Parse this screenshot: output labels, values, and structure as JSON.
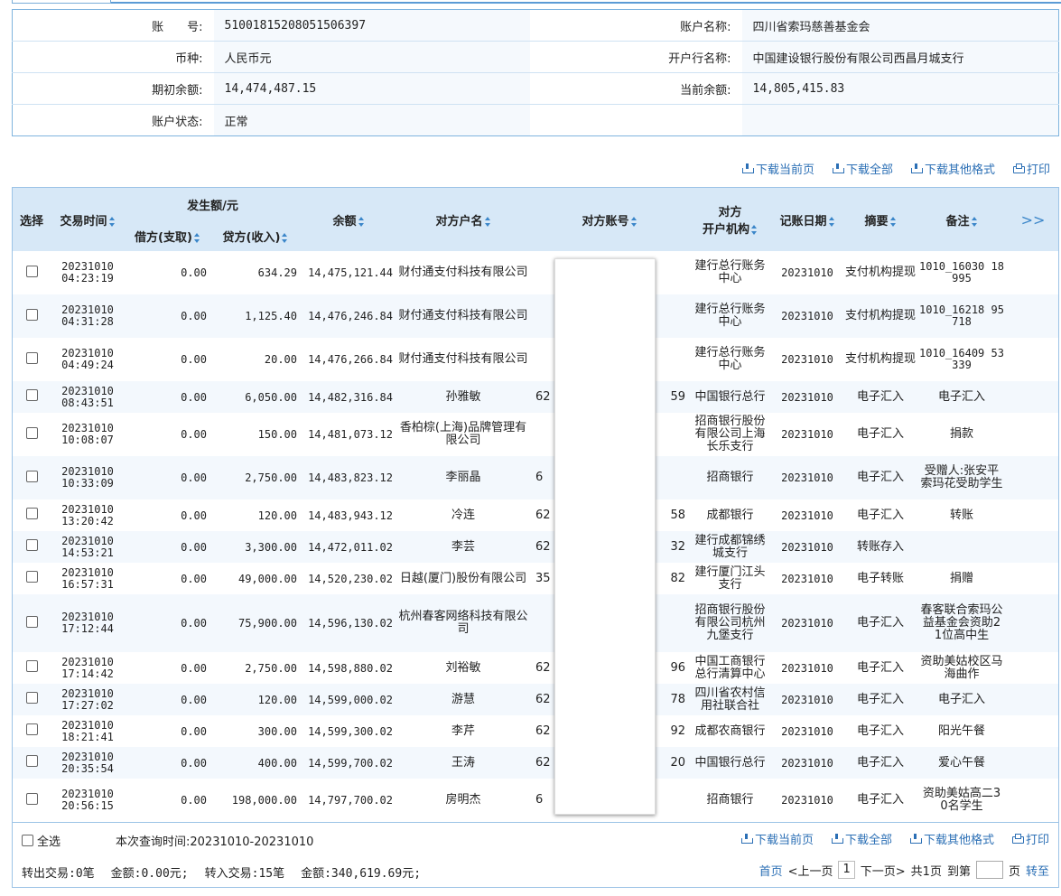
{
  "account": {
    "acct_no_label": "账　　号:",
    "acct_no": "51001815208051506397",
    "acct_name_label": "账户名称:",
    "acct_name": "四川省索玛慈善基金会",
    "currency_label": "币种:",
    "currency": "人民币元",
    "bank_label": "开户行名称:",
    "bank": "中国建设银行股份有限公司西昌月城支行",
    "opening_label": "期初余额:",
    "opening": "14,474,487.15",
    "current_label": "当前余额:",
    "current": "14,805,415.83",
    "status_label": "账户状态:",
    "status": "正常"
  },
  "toolbar": {
    "download_page": "下载当前页",
    "download_all": "下载全部",
    "download_other": "下载其他格式",
    "print": "打印"
  },
  "headers": {
    "select": "选择",
    "time": "交易时间",
    "amount_group": "发生额/元",
    "debit": "借方(支取)",
    "credit": "贷方(收入)",
    "balance": "余额",
    "cp_name": "对方户名",
    "cp_acct": "对方账号",
    "cp_bank_l1": "对方",
    "cp_bank_l2": "开户机构",
    "book_date": "记账日期",
    "summary": "摘要",
    "remark": "备注",
    "more": ">>"
  },
  "rows": [
    {
      "date": "20231010",
      "time": "04:23:19",
      "debit": "0.00",
      "credit": "634.29",
      "balance": "14,475,121.44",
      "cp_name": "财付通支付科技有限公司",
      "acct_l": "",
      "acct_r": "",
      "cp_bank": "建行总行账务中心",
      "book": "20231010",
      "summary": "支付机构提现",
      "remark": "1010_16030 18995",
      "remark_mono": true
    },
    {
      "date": "20231010",
      "time": "04:31:28",
      "debit": "0.00",
      "credit": "1,125.40",
      "balance": "14,476,246.84",
      "cp_name": "财付通支付科技有限公司",
      "acct_l": "",
      "acct_r": "",
      "cp_bank": "建行总行账务中心",
      "book": "20231010",
      "summary": "支付机构提现",
      "remark": "1010_16218 95718",
      "remark_mono": true
    },
    {
      "date": "20231010",
      "time": "04:49:24",
      "debit": "0.00",
      "credit": "20.00",
      "balance": "14,476,266.84",
      "cp_name": "财付通支付科技有限公司",
      "acct_l": "",
      "acct_r": "",
      "cp_bank": "建行总行账务中心",
      "book": "20231010",
      "summary": "支付机构提现",
      "remark": "1010_16409 53339",
      "remark_mono": true
    },
    {
      "date": "20231010",
      "time": "08:43:51",
      "debit": "0.00",
      "credit": "6,050.00",
      "balance": "14,482,316.84",
      "cp_name": "孙雅敏",
      "acct_l": "62",
      "acct_r": "59",
      "cp_bank": "中国银行总行",
      "book": "20231010",
      "summary": "电子汇入",
      "remark": "电子汇入",
      "remark_mono": false
    },
    {
      "date": "20231010",
      "time": "10:08:07",
      "debit": "0.00",
      "credit": "150.00",
      "balance": "14,481,073.12",
      "cp_name": "香柏棕(上海)品牌管理有限公司",
      "acct_l": "",
      "acct_r": "",
      "cp_bank": "招商银行股份有限公司上海长乐支行",
      "book": "20231010",
      "summary": "电子汇入",
      "remark": "捐款",
      "remark_mono": false
    },
    {
      "date": "20231010",
      "time": "10:33:09",
      "debit": "0.00",
      "credit": "2,750.00",
      "balance": "14,483,823.12",
      "cp_name": "李丽晶",
      "acct_l": "6",
      "acct_r": "",
      "cp_bank": "招商银行",
      "book": "20231010",
      "summary": "电子汇入",
      "remark": "受赠人:张安平索玛花受助学生",
      "remark_mono": false
    },
    {
      "date": "20231010",
      "time": "13:20:42",
      "debit": "0.00",
      "credit": "120.00",
      "balance": "14,483,943.12",
      "cp_name": "冷连",
      "acct_l": "62",
      "acct_r": "58",
      "cp_bank": "成都银行",
      "book": "20231010",
      "summary": "电子汇入",
      "remark": "转账",
      "remark_mono": false
    },
    {
      "date": "20231010",
      "time": "14:53:21",
      "debit": "0.00",
      "credit": "3,300.00",
      "balance": "14,472,011.02",
      "cp_name": "李芸",
      "acct_l": "62",
      "acct_r": "32",
      "cp_bank": "建行成都锦绣城支行",
      "book": "20231010",
      "summary": "转账存入",
      "remark": "",
      "remark_mono": false
    },
    {
      "date": "20231010",
      "time": "16:57:31",
      "debit": "0.00",
      "credit": "49,000.00",
      "balance": "14,520,230.02",
      "cp_name": "日越(厦门)股份有限公司",
      "acct_l": "35",
      "acct_r": "82",
      "cp_bank": "建行厦门江头支行",
      "book": "20231010",
      "summary": "电子转账",
      "remark": "捐赠",
      "remark_mono": false
    },
    {
      "date": "20231010",
      "time": "17:12:44",
      "debit": "0.00",
      "credit": "75,900.00",
      "balance": "14,596,130.02",
      "cp_name": "杭州春客网络科技有限公司",
      "acct_l": "",
      "acct_r": "",
      "cp_bank": "招商银行股份有限公司杭州九堡支行",
      "book": "20231010",
      "summary": "电子汇入",
      "remark": "春客联合索玛公益基金会资助21位高中生",
      "remark_mono": false
    },
    {
      "date": "20231010",
      "time": "17:14:42",
      "debit": "0.00",
      "credit": "2,750.00",
      "balance": "14,598,880.02",
      "cp_name": "刘裕敏",
      "acct_l": "62",
      "acct_r": "96",
      "cp_bank": "中国工商银行总行清算中心",
      "book": "20231010",
      "summary": "电子汇入",
      "remark": "资助美姑校区马海曲作",
      "remark_mono": false
    },
    {
      "date": "20231010",
      "time": "17:27:02",
      "debit": "0.00",
      "credit": "120.00",
      "balance": "14,599,000.02",
      "cp_name": "游慧",
      "acct_l": "62",
      "acct_r": "78",
      "cp_bank": "四川省农村信用社联合社",
      "book": "20231010",
      "summary": "电子汇入",
      "remark": "电子汇入",
      "remark_mono": false
    },
    {
      "date": "20231010",
      "time": "18:21:41",
      "debit": "0.00",
      "credit": "300.00",
      "balance": "14,599,300.02",
      "cp_name": "李芹",
      "acct_l": "62",
      "acct_r": "92",
      "cp_bank": "成都农商银行",
      "book": "20231010",
      "summary": "电子汇入",
      "remark": "阳光午餐",
      "remark_mono": false
    },
    {
      "date": "20231010",
      "time": "20:35:54",
      "debit": "0.00",
      "credit": "400.00",
      "balance": "14,599,700.02",
      "cp_name": "王涛",
      "acct_l": "62",
      "acct_r": "20",
      "cp_bank": "中国银行总行",
      "book": "20231010",
      "summary": "电子汇入",
      "remark": "爱心午餐",
      "remark_mono": false
    },
    {
      "date": "20231010",
      "time": "20:56:15",
      "debit": "0.00",
      "credit": "198,000.00",
      "balance": "14,797,700.02",
      "cp_name": "房明杰",
      "acct_l": "6",
      "acct_r": "",
      "cp_bank": "招商银行",
      "book": "20231010",
      "summary": "电子汇入",
      "remark": "资助美姑高二30名学生",
      "remark_mono": false
    }
  ],
  "row_heights": [],
  "footer": {
    "select_all": "全选",
    "query_time": "本次查询时间:20231010-20231010",
    "out_trans": "转出交易:0笔",
    "out_amount": "金额:0.00元;",
    "in_trans": "转入交易:15笔",
    "in_amount": "金额:340,619.69元;",
    "first": "首页",
    "prev": "<上一页",
    "page": "1",
    "next": "下一页>",
    "total": "共1页",
    "goto": "到第",
    "page_unit": "页",
    "go": "转至"
  }
}
